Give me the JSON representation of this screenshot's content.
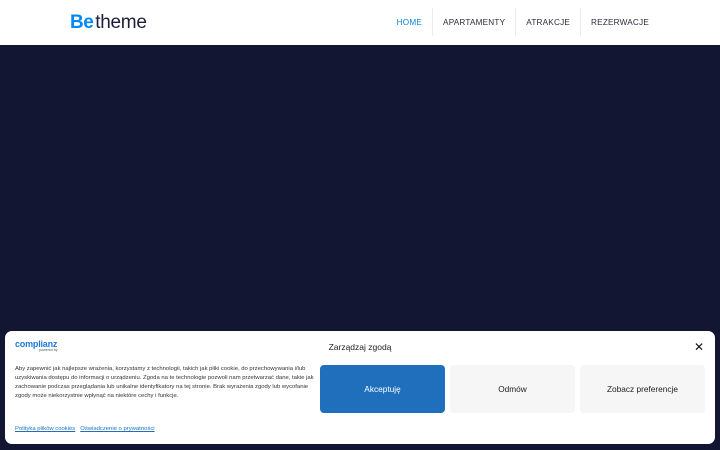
{
  "header": {
    "logo": {
      "be": "Be",
      "theme": "theme"
    },
    "nav": [
      {
        "label": "HOME",
        "active": true
      },
      {
        "label": "APARTAMENTY",
        "active": false
      },
      {
        "label": "ATRAKCJE",
        "active": false
      },
      {
        "label": "REZERWACJE",
        "active": false
      }
    ]
  },
  "cookie_banner": {
    "brand_name": "complianz",
    "brand_powered": "powered by",
    "title": "Zarządzaj zgodą",
    "close_icon": "close-icon",
    "text": "Aby zapewnić jak najlepsze wrażenia, korzystamy z technologii, takich jak pliki cookie, do przechowywania i/lub uzyskiwania dostępu do informacji o urządzeniu. Zgoda na te technologie pozwoli nam przetwarzać dane, takie jak zachowanie podczas przeglądania lub unikalne identyfikatory na tej stronie. Brak wyrażenia zgody lub wycofanie zgody może niekorzystnie wpłynąć na niektóre cechy i funkcje.",
    "buttons": {
      "accept": "Akceptuję",
      "deny": "Odmów",
      "preferences": "Zobacz preferencje"
    },
    "links": {
      "cookie_policy": "Polityka plików cookies",
      "privacy_statement": "Oświadczenie o prywatności"
    }
  },
  "colors": {
    "accent": "#0089f7",
    "hero_background": "#121632",
    "accept_button": "#1f6fbd"
  }
}
